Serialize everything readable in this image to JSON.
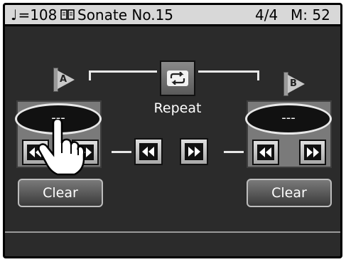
{
  "status_bar": {
    "tempo_note": "♩",
    "tempo": "=108",
    "book_icon": "music-book-icon",
    "song_title": "Sonate No.15",
    "beat": "4/4",
    "measure": "M: 52"
  },
  "repeat": {
    "label": "Repeat",
    "icon": "repeat-loop-icon"
  },
  "marker_a": {
    "flag_letter": "A",
    "display_value": "---",
    "clear_label": "Clear"
  },
  "marker_b": {
    "flag_letter": "B",
    "display_value": "---",
    "clear_label": "Clear"
  },
  "center_nav": {
    "rewind_icon": "rewind-icon",
    "forward_icon": "fast-forward-icon"
  },
  "colors": {
    "screen_bg": "#2b2b2b",
    "status_bg": "#d8d8d8",
    "accent_light": "#e8e8e8"
  }
}
